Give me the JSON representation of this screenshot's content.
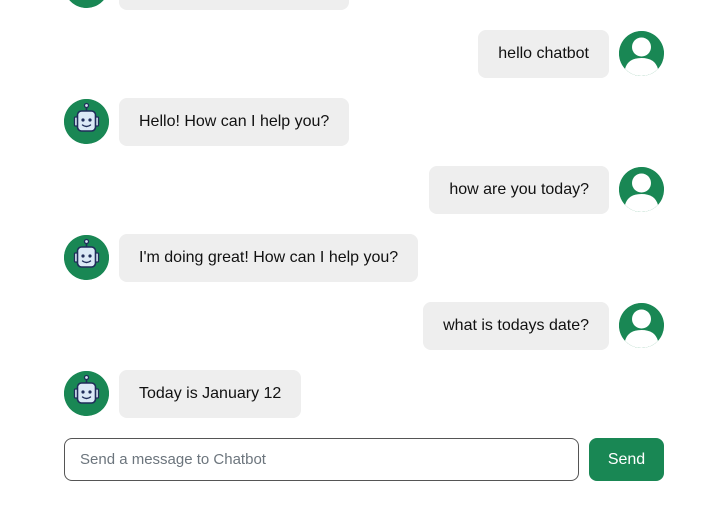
{
  "messages": [
    {
      "role": "bot",
      "text": ""
    },
    {
      "role": "user",
      "text": "hello chatbot"
    },
    {
      "role": "bot",
      "text": "Hello! How can I help you?"
    },
    {
      "role": "user",
      "text": "how are you today?"
    },
    {
      "role": "bot",
      "text": "I'm doing great! How can I help you?"
    },
    {
      "role": "user",
      "text": "what is todays date?"
    },
    {
      "role": "bot",
      "text": "Today is January 12"
    }
  ],
  "composer": {
    "placeholder": "Send a message to Chatbot",
    "value": "",
    "send_label": "Send"
  },
  "icons": {
    "bot_avatar": "robot-icon",
    "user_avatar": "user-icon"
  },
  "colors": {
    "accent": "#198754",
    "bubble": "#eeeeee",
    "robot_face": "#dbe9f6",
    "robot_outline": "#1f2d5a"
  }
}
